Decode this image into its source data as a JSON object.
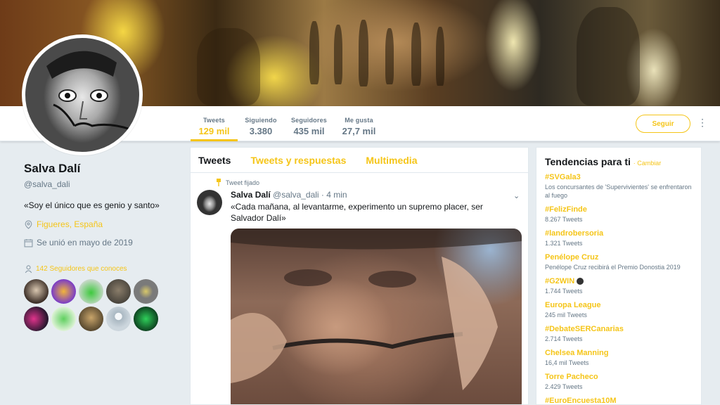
{
  "profile": {
    "name": "Salva Dalí",
    "handle": "@salva_dali",
    "bio": "«Soy el único que es genio y santo»",
    "location": "Figueres, España",
    "joined": "Se unió en mayo de 2019",
    "followers_you_know": "142 Seguidores que conoces"
  },
  "stats": [
    {
      "label": "Tweets",
      "value": "129 mil"
    },
    {
      "label": "Siguiendo",
      "value": "3.380"
    },
    {
      "label": "Seguidores",
      "value": "435 mil"
    },
    {
      "label": "Me gusta",
      "value": "27,7 mil"
    }
  ],
  "follow_label": "Seguir",
  "more_label": "⋮",
  "tabs": [
    "Tweets",
    "Tweets y respuestas",
    "Multimedia"
  ],
  "tweet": {
    "pinned_label": "Tweet fijado",
    "name": "Salva Dalí",
    "handle_time": "@salva_dali · 4 min",
    "text": "«Cada mañana, al levantarme, experimento un supremo placer, ser Salvador Dalí»"
  },
  "trends_box": {
    "title": "Tendencias para ti",
    "change": "· Cambiar",
    "items": [
      {
        "name": "#SVGala3",
        "detail": "Los concursantes de 'Supervivientes' se enfrentaron al fuego"
      },
      {
        "name": "#FelizFinde",
        "detail": "8.267 Tweets"
      },
      {
        "name": "#landrobersoria",
        "detail": "1.321 Tweets"
      },
      {
        "name": "Penélope Cruz",
        "detail": "Penélope Cruz recibirá el Premio Donostia 2019"
      },
      {
        "name": "#G2WIN",
        "detail": "1.744 Tweets"
      },
      {
        "name": "Europa League",
        "detail": "245 mil Tweets"
      },
      {
        "name": "#DebateSERCanarias",
        "detail": "2.714 Tweets"
      },
      {
        "name": "Chelsea Manning",
        "detail": "16,4 mil Tweets"
      },
      {
        "name": "Torre Pacheco",
        "detail": "2.429 Tweets"
      },
      {
        "name": "#EuroEncuesta10M",
        "detail": ""
      }
    ]
  },
  "colors": {
    "accent": "#f5c518",
    "muted": "#657786",
    "text": "#14171a",
    "page_bg": "#e6ecf0"
  }
}
